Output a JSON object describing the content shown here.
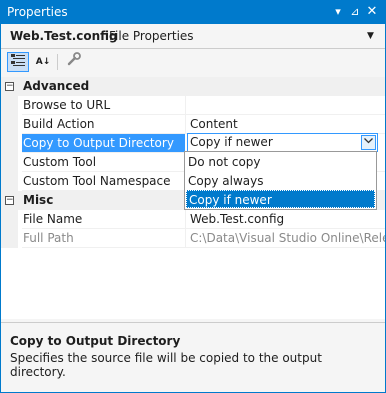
{
  "window": {
    "title": "Properties",
    "controls": {
      "dropdown": "▾",
      "pin": "⊿",
      "close": "✕"
    }
  },
  "object_selector": {
    "name": "Web.Test.config",
    "type": "File Properties"
  },
  "toolbar": {
    "categorized_icon": "categorized-icon",
    "alphabetical_icon": "alphabetical-icon",
    "alpha_glyph": "A↓",
    "property_pages_icon": "wrench-icon"
  },
  "categories": [
    {
      "name": "Advanced",
      "expanded": true,
      "properties": [
        {
          "name": "Browse to URL",
          "value": ""
        },
        {
          "name": "Build Action",
          "value": "Content"
        },
        {
          "name": "Copy to Output Directory",
          "value": "Copy if newer",
          "selected": true
        },
        {
          "name": "Custom Tool",
          "value": ""
        },
        {
          "name": "Custom Tool Namespace",
          "value": ""
        }
      ]
    },
    {
      "name": "Misc",
      "expanded": true,
      "properties": [
        {
          "name": "File Name",
          "value": "Web.Test.config"
        },
        {
          "name": "Full Path",
          "value": "C:\\Data\\Visual Studio Online\\Releas",
          "disabled": true
        }
      ]
    }
  ],
  "dropdown": {
    "current": "Copy if newer",
    "options": [
      "Do not copy",
      "Copy always",
      "Copy if newer"
    ],
    "highlighted_index": 2
  },
  "description": {
    "title": "Copy to Output Directory",
    "text": "Specifies the source file will be copied to the output directory."
  },
  "colors": {
    "accent": "#007acc",
    "selection": "#3399ff"
  }
}
